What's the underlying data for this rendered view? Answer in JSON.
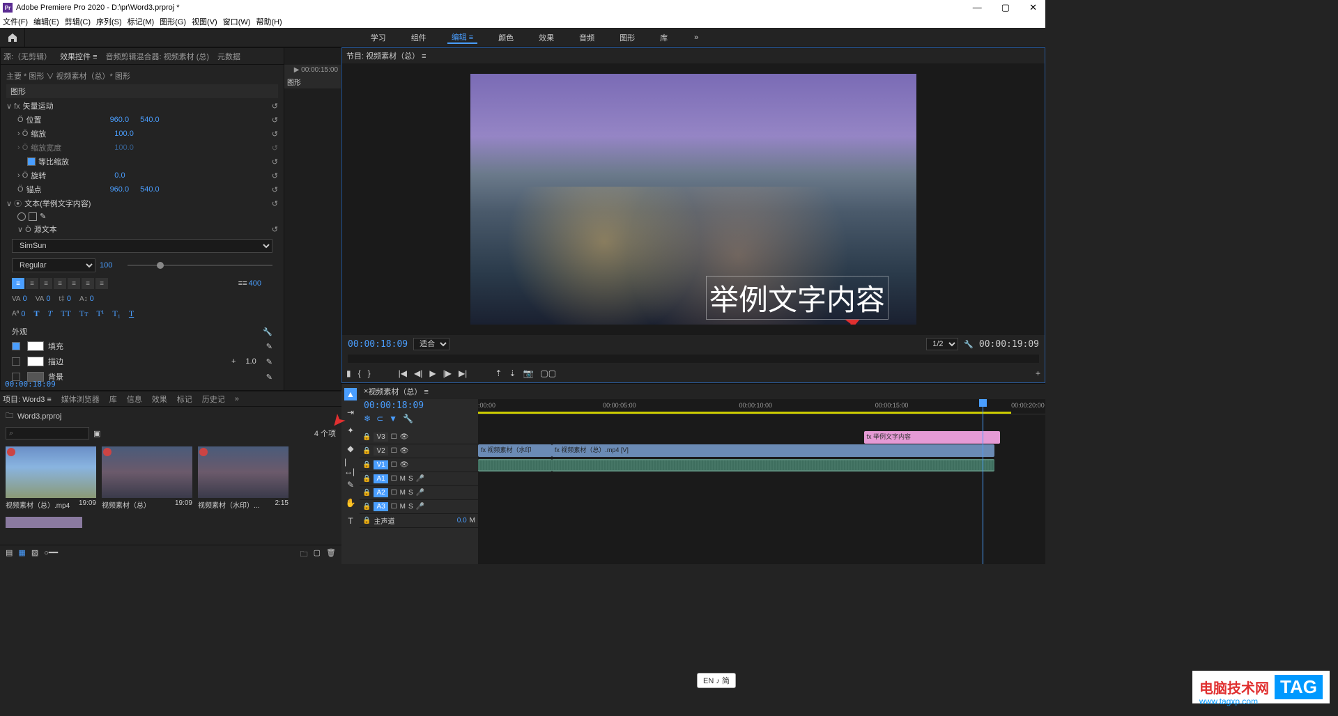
{
  "titlebar": {
    "app": "Adobe Premiere Pro 2020",
    "project": "D:\\pr\\Word3.prproj *"
  },
  "menubar": [
    "文件(F)",
    "编辑(E)",
    "剪辑(C)",
    "序列(S)",
    "标记(M)",
    "图形(G)",
    "视图(V)",
    "窗口(W)",
    "帮助(H)"
  ],
  "workspaces": {
    "items": [
      "学习",
      "组件",
      "编辑",
      "颜色",
      "效果",
      "音频",
      "图形",
      "库"
    ],
    "active": 2,
    "more": "»"
  },
  "source_tabs": {
    "items": [
      "源:（无剪辑）",
      "效果控件 ≡",
      "音频剪辑混合器: 视频素材 (总)",
      "元数据"
    ],
    "active": 1
  },
  "effect_controls": {
    "header_path": "主要 * 图形  ∨  视频素材（总）* 图形",
    "header_time": "00:00:15:00",
    "section_graphic": "图形",
    "timeline_label": "图形",
    "vector_motion": "矢量运动",
    "position": {
      "label": "位置",
      "x": "960.0",
      "y": "540.0"
    },
    "scale": {
      "label": "缩放",
      "val": "100.0"
    },
    "scale_width": {
      "label": "缩放宽度",
      "val": "100.0"
    },
    "uniform_scale": "等比缩放",
    "rotation": {
      "label": "旋转",
      "val": "0.0"
    },
    "anchor": {
      "label": "锚点",
      "x": "960.0",
      "y": "540.0"
    },
    "text_layer": "文本(举例文字内容)",
    "source_text": "源文本",
    "font": "SimSun",
    "font_style": "Regular",
    "font_size": "100",
    "tracking": "400",
    "va1": "0",
    "va2": "0",
    "baseline": "0",
    "tsume": "0",
    "kern": "0",
    "appearance": "外观",
    "fill": "填充",
    "stroke": "描边",
    "stroke_w": "1.0",
    "shadow": "背景",
    "timecode": "00:00:18:09"
  },
  "project": {
    "tabs": [
      "项目: Word3 ≡",
      "媒体浏览器",
      "库",
      "信息",
      "效果",
      "标记",
      "历史记"
    ],
    "file": "Word3.prproj",
    "count": "4 个项",
    "items": [
      {
        "name": "视频素材（总）.mp4",
        "dur": "19:09"
      },
      {
        "name": "视频素材（总）",
        "dur": "19:09"
      },
      {
        "name": "视频素材（水印）...",
        "dur": "2:15"
      }
    ]
  },
  "program": {
    "title": "节目: 视频素材（总） ≡",
    "overlay_text": "举例文字内容",
    "tc_current": "00:00:18:09",
    "fit": "适合",
    "zoom": "1/2",
    "tc_total": "00:00:19:09"
  },
  "timeline": {
    "title": "视频素材（总） ≡",
    "tc": "00:00:18:09",
    "ruler": [
      ":00:00",
      "00:00:05:00",
      "00:00:10:00",
      "00:00:15:00",
      "00:00:20:00"
    ],
    "tracks_v": [
      "V3",
      "V2",
      "V1"
    ],
    "tracks_a": [
      "A1",
      "A2",
      "A3"
    ],
    "master": "主声道",
    "master_val": "0.0",
    "clip_graphic": "举例文字内容",
    "clip_video1": "视频素材（水印",
    "clip_video2": "视频素材（总）.mp4 [V]"
  },
  "ime": "EN ♪ 简",
  "watermark": {
    "text": "电脑技术网",
    "tag": "TAG",
    "url": "www.tagxp.com"
  }
}
